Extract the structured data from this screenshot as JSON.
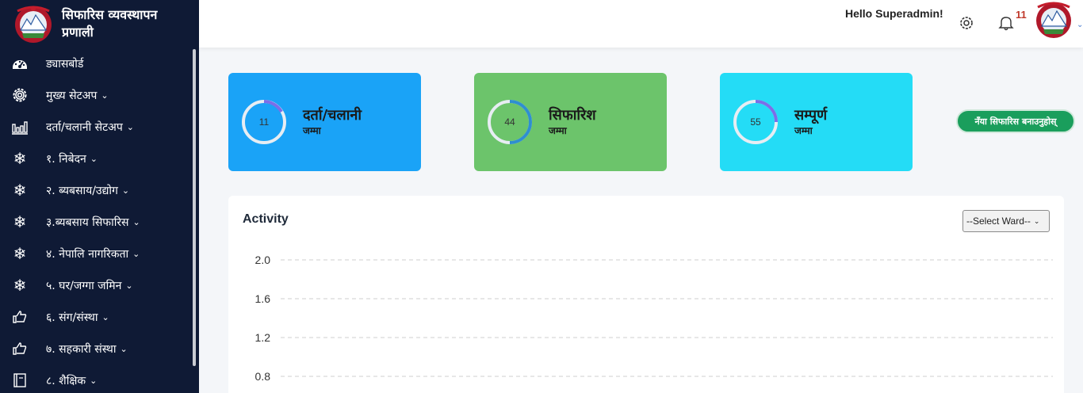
{
  "brand": {
    "name": "सिफारिस व्यवस्थापन प्रणाली"
  },
  "sidebar": {
    "items": [
      {
        "label": "ड्यासबोर्ड",
        "icon": "dashboard-icon",
        "has_submenu": false
      },
      {
        "label": "मुख्य सेटअप",
        "icon": "gear-icon",
        "has_submenu": true
      },
      {
        "label": "दर्ता/चलानी सेटअप",
        "icon": "bar-chart-icon",
        "has_submenu": true
      },
      {
        "label": "१. निबेदन",
        "icon": "snowflake-icon",
        "has_submenu": true
      },
      {
        "label": "२. ब्यबसाय/उद्योग",
        "icon": "snowflake-icon",
        "has_submenu": true
      },
      {
        "label": "३.ब्यबसाय सिफारिस",
        "icon": "snowflake-icon",
        "has_submenu": true
      },
      {
        "label": "४. नेपालि नागरिकता",
        "icon": "snowflake-icon",
        "has_submenu": true
      },
      {
        "label": "५. घर/जग्गा जमिन",
        "icon": "snowflake-icon",
        "has_submenu": true
      },
      {
        "label": "६. संग/संस्था",
        "icon": "thumbs-up-icon",
        "has_submenu": true
      },
      {
        "label": "७. सहकारी संस्था",
        "icon": "thumbs-up-icon",
        "has_submenu": true
      },
      {
        "label": "८. शैक्षिक",
        "icon": "book-icon",
        "has_submenu": true
      }
    ]
  },
  "header": {
    "greeting": "Hello Superadmin!",
    "notification_count": "11"
  },
  "cards": [
    {
      "count": "11",
      "title": "दर्ता/चलानी",
      "subtitle": "जम्मा",
      "color": "#1aa3f7"
    },
    {
      "count": "44",
      "title": "सिफारिश",
      "subtitle": "जम्मा",
      "color": "#6cc46b"
    },
    {
      "count": "55",
      "title": "सम्पूर्ण",
      "subtitle": "जम्मा",
      "color": "#24dcf6"
    }
  ],
  "new_button": {
    "label": "नँया सिफारिस बनाउनुहोस्"
  },
  "activity": {
    "title": "Activity",
    "ward_select": {
      "selected": "--Select Ward--"
    }
  },
  "chart_data": {
    "type": "line",
    "title": "Activity",
    "yticks": [
      "2.0",
      "1.6",
      "1.2",
      "0.8"
    ],
    "ylim": [
      0,
      2.0
    ],
    "grid": true,
    "series": []
  }
}
